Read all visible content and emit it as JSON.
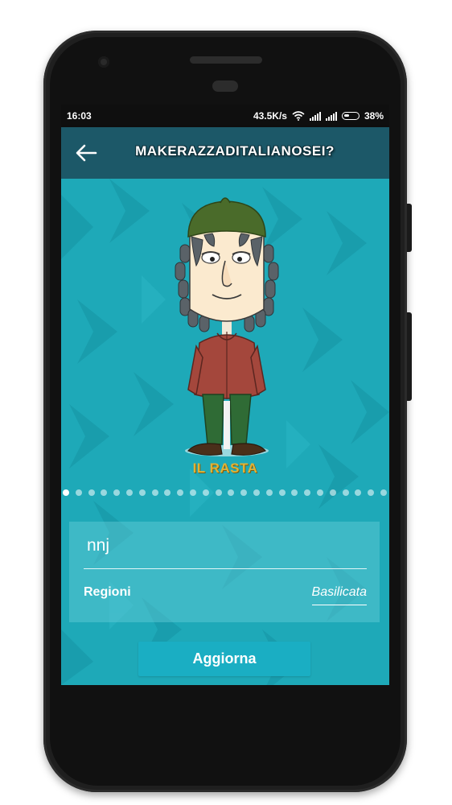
{
  "status_bar": {
    "time": "16:03",
    "speed": "43.5K/s",
    "battery_percent": "38%"
  },
  "app_bar": {
    "title": "MAKERAZZADITALIANOSEI?",
    "back_icon": "arrow-left-icon"
  },
  "character": {
    "name": "IL RASTA"
  },
  "pager": {
    "count": 26,
    "active_index": 0
  },
  "form": {
    "name_value": "nnj",
    "regioni_label": "Regioni",
    "regioni_value": "Basilicata"
  },
  "actions": {
    "update_label": "Aggiorna"
  },
  "colors": {
    "app_bar": "#1c5868",
    "background": "#1ea9b8",
    "button": "#1aaec3",
    "character_name": "#e1b235"
  }
}
